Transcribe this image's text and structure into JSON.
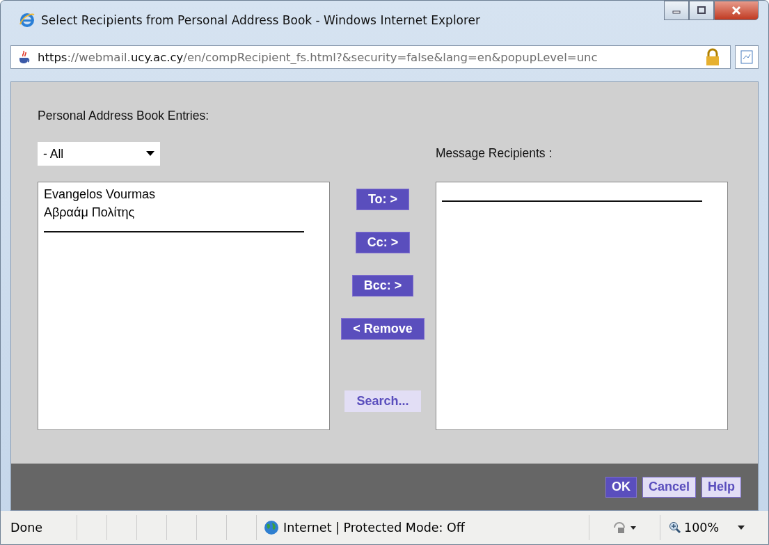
{
  "window": {
    "title": "Select Recipients from Personal Address Book - Windows Internet Explorer"
  },
  "address_bar": {
    "url_parts": [
      {
        "text": "https",
        "emphasis": true
      },
      {
        "text": "://webmail.",
        "emphasis": false
      },
      {
        "text": "ucy.ac.cy",
        "emphasis": true
      },
      {
        "text": "/en/compRecipient_fs.html?&security=false&lang=en&popupLevel=unc",
        "emphasis": false
      }
    ]
  },
  "entries_label": "Personal Address Book Entries:",
  "filter": {
    "value": "- All"
  },
  "recipients_label": "Message Recipients :",
  "entries": [
    {
      "kind": "entry",
      "text": "Evangelos Vourmas"
    },
    {
      "kind": "entry",
      "text": "Αβραάμ Πολίτης"
    },
    {
      "kind": "separator"
    }
  ],
  "recipients": [
    {
      "kind": "separator"
    }
  ],
  "move_buttons": [
    {
      "label": "To: >",
      "kind": "primary"
    },
    {
      "label": "Cc: >",
      "kind": "primary"
    },
    {
      "label": "Bcc: >",
      "kind": "primary"
    },
    {
      "label": "< Remove",
      "kind": "primary"
    }
  ],
  "search_button": {
    "label": "Search...",
    "kind": "secondary"
  },
  "footer_buttons": [
    {
      "label": "OK",
      "kind": "primary"
    },
    {
      "label": "Cancel",
      "kind": "secondary"
    },
    {
      "label": "Help",
      "kind": "secondary"
    }
  ],
  "status_bar": {
    "status": "Done",
    "zone": "Internet | Protected Mode: Off",
    "zoom": "100%"
  }
}
